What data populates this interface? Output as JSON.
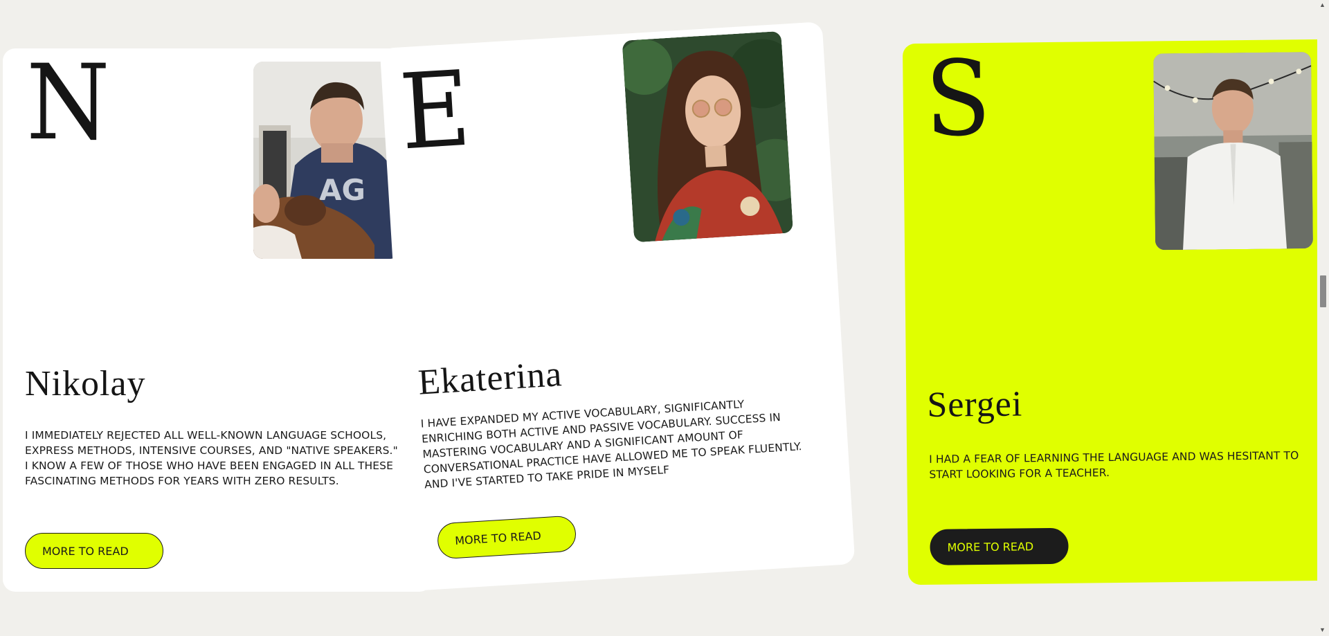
{
  "cards": [
    {
      "initial": "N",
      "name": "Nikolay",
      "quote": "I immediately rejected all well-known language schools, express methods, intensive courses, and \"native speakers.\" I know a few of those who have been engaged in all these fascinating methods for years with zero results.",
      "button_label": "MORE TO READ",
      "photo": "man-with-dog-photo"
    },
    {
      "initial": "E",
      "name": "Ekaterina",
      "quote": "I have expanded my active vocabulary, significantly enriching both active and passive vocabulary. Success in mastering vocabulary and a significant amount of conversational practice have allowed me to speak fluently. And I've started to take pride in myself",
      "button_label": "MORE TO READ",
      "photo": "woman-with-sunglasses-photo"
    },
    {
      "initial": "S",
      "name": "Sergei",
      "quote": "I had a fear of learning the language and was hesitant to start looking for a teacher.",
      "button_label": "MORE TO READ",
      "photo": "man-in-white-shirt-photo"
    }
  ],
  "colors": {
    "background": "#f1f0ec",
    "accent_lime": "#e0ff00",
    "card_white": "#ffffff",
    "text_dark": "#151515"
  }
}
